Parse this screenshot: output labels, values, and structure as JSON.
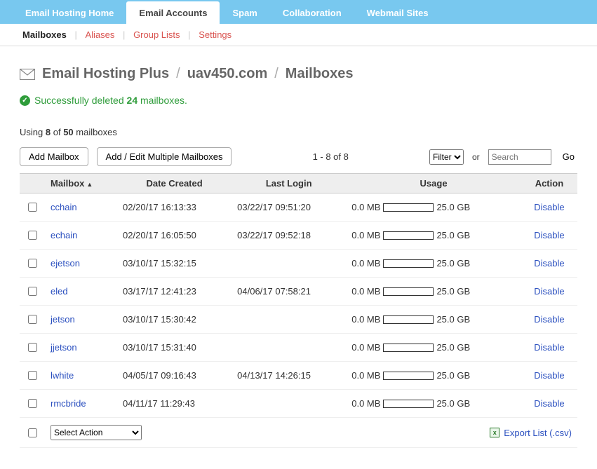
{
  "topnav": {
    "tabs": [
      {
        "label": "Email Hosting Home"
      },
      {
        "label": "Email Accounts"
      },
      {
        "label": "Spam"
      },
      {
        "label": "Collaboration"
      },
      {
        "label": "Webmail Sites"
      }
    ],
    "active_index": 1
  },
  "subnav": {
    "items": [
      "Mailboxes",
      "Aliases",
      "Group Lists",
      "Settings"
    ],
    "active_index": 0
  },
  "breadcrumb": {
    "product": "Email Hosting Plus",
    "domain": "uav450.com",
    "section": "Mailboxes"
  },
  "alert": {
    "prefix": "Successfully deleted",
    "count": "24",
    "suffix": "mailboxes."
  },
  "quota": {
    "prefix": "Using",
    "used": "8",
    "of": "of",
    "total": "50",
    "suffix": "mailboxes"
  },
  "toolbar": {
    "add_label": "Add Mailbox",
    "bulk_label": "Add / Edit Multiple Mailboxes",
    "page_range": "1 - 8 of 8",
    "filter_label": "Filter",
    "or_label": "or",
    "search_placeholder": "Search",
    "go_label": "Go"
  },
  "table": {
    "columns": {
      "mailbox": "Mailbox",
      "date_created": "Date Created",
      "last_login": "Last Login",
      "usage": "Usage",
      "action": "Action"
    },
    "rows": [
      {
        "mailbox": "cchain",
        "date_created": "02/20/17 16:13:33",
        "last_login": "03/22/17 09:51:20",
        "usage_used": "0.0 MB",
        "usage_total": "25.0 GB",
        "action": "Disable"
      },
      {
        "mailbox": "echain",
        "date_created": "02/20/17 16:05:50",
        "last_login": "03/22/17 09:52:18",
        "usage_used": "0.0 MB",
        "usage_total": "25.0 GB",
        "action": "Disable"
      },
      {
        "mailbox": "ejetson",
        "date_created": "03/10/17 15:32:15",
        "last_login": "",
        "usage_used": "0.0 MB",
        "usage_total": "25.0 GB",
        "action": "Disable"
      },
      {
        "mailbox": "eled",
        "date_created": "03/17/17 12:41:23",
        "last_login": "04/06/17 07:58:21",
        "usage_used": "0.0 MB",
        "usage_total": "25.0 GB",
        "action": "Disable"
      },
      {
        "mailbox": "jetson",
        "date_created": "03/10/17 15:30:42",
        "last_login": "",
        "usage_used": "0.0 MB",
        "usage_total": "25.0 GB",
        "action": "Disable"
      },
      {
        "mailbox": "jjetson",
        "date_created": "03/10/17 15:31:40",
        "last_login": "",
        "usage_used": "0.0 MB",
        "usage_total": "25.0 GB",
        "action": "Disable"
      },
      {
        "mailbox": "lwhite",
        "date_created": "04/05/17 09:16:43",
        "last_login": "04/13/17 14:26:15",
        "usage_used": "0.0 MB",
        "usage_total": "25.0 GB",
        "action": "Disable"
      },
      {
        "mailbox": "rmcbride",
        "date_created": "04/11/17 11:29:43",
        "last_login": "",
        "usage_used": "0.0 MB",
        "usage_total": "25.0 GB",
        "action": "Disable"
      }
    ]
  },
  "footer": {
    "select_action_label": "Select Action",
    "export_label": "Export List (.csv)"
  }
}
